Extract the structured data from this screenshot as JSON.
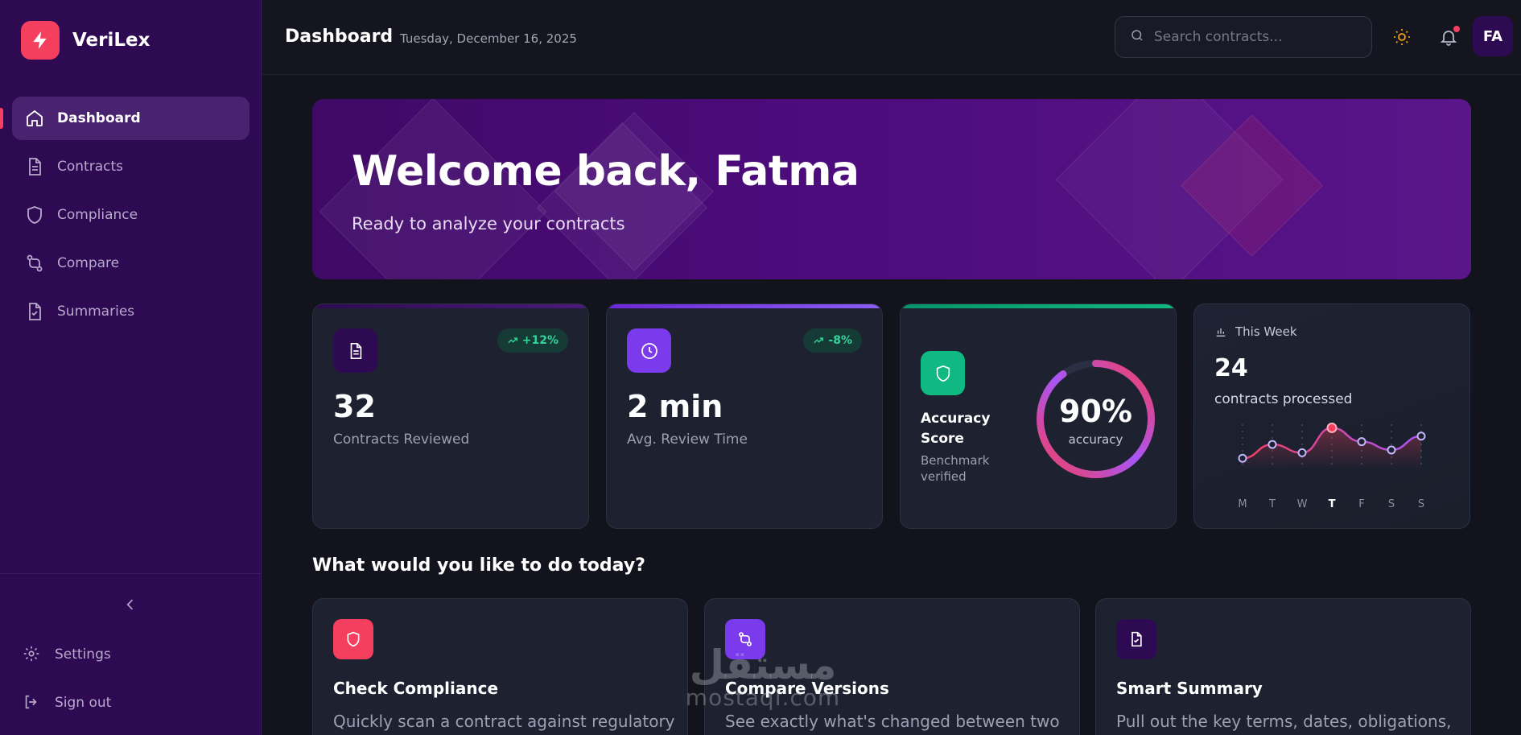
{
  "app": {
    "name": "VeriLex"
  },
  "sidebar": {
    "items": [
      {
        "label": "Dashboard",
        "active": true
      },
      {
        "label": "Contracts"
      },
      {
        "label": "Compliance"
      },
      {
        "label": "Compare"
      },
      {
        "label": "Summaries"
      }
    ],
    "settings_label": "Settings",
    "signout_label": "Sign out"
  },
  "header": {
    "title": "Dashboard",
    "date": "Tuesday, December 16, 2025",
    "search_placeholder": "Search contracts...",
    "avatar_initials": "FA"
  },
  "hero": {
    "title": "Welcome back, Fatma",
    "subtitle": "Ready to analyze your contracts"
  },
  "stats": {
    "reviewed": {
      "value": "32",
      "label": "Contracts Reviewed",
      "trend": "+12%"
    },
    "time": {
      "value": "2 min",
      "label": "Avg. Review Time",
      "trend": "-8%"
    },
    "accuracy": {
      "title": "Accuracy Score",
      "subtitle": "Benchmark verified",
      "value": "90%",
      "value_label": "accuracy",
      "fraction": 0.9
    },
    "week": {
      "heading": "This Week",
      "value": "24",
      "label": "contracts processed",
      "days": [
        "M",
        "T",
        "W",
        "T",
        "F",
        "S",
        "S"
      ],
      "active_day_index": 3,
      "series": [
        2,
        4.5,
        3,
        7.5,
        5,
        3.5,
        6
      ]
    }
  },
  "actions": {
    "heading": "What would you like to do today?",
    "cards": [
      {
        "title": "Check Compliance",
        "desc": "Quickly scan a contract against regulatory"
      },
      {
        "title": "Compare Versions",
        "desc": "See exactly what's changed between two"
      },
      {
        "title": "Smart Summary",
        "desc": "Pull out the key terms, dates, obligations,"
      }
    ]
  },
  "watermark": {
    "line1": "مستقل",
    "line2": "mostaql.com"
  },
  "colors": {
    "accent": "#f43f5e",
    "purple": "#7c3aed",
    "green": "#10b981",
    "sidebar": "#2e0a52"
  }
}
